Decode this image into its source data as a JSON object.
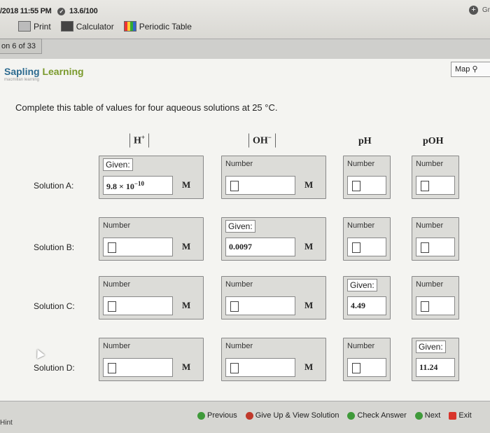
{
  "top": {
    "datetime": "/2018 11:55 PM",
    "score": "13.6/100",
    "gr_label": "Gr"
  },
  "tools": [
    "Print",
    "Calculator",
    "Periodic Table"
  ],
  "question_counter": "on 6 of 33",
  "logo": {
    "name_a": "Sapling",
    "name_b": " Learning",
    "sub": "macmillan learning"
  },
  "map_label": "Map",
  "prompt": "Complete this table of values for four aqueous solutions at 25 °C.",
  "columns": {
    "h": "H",
    "h_sup": "+",
    "oh": "OH",
    "oh_sup": "−",
    "ph": "pH",
    "poh": "pOH"
  },
  "unit": "M",
  "labels": {
    "number": "Number",
    "given": "Given:"
  },
  "rows": [
    {
      "label": "Solution A:",
      "h_value": "9.8 × 10",
      "h_exp": "−10"
    },
    {
      "label": "Solution B:",
      "oh_value": "0.0097"
    },
    {
      "label": "Solution C:",
      "ph_value": "4.49"
    },
    {
      "label": "Solution D:",
      "poh_value": "11.24"
    }
  ],
  "footer": {
    "hint": "Hint",
    "previous": "Previous",
    "giveup": "Give Up & View Solution",
    "check": "Check Answer",
    "next": "Next",
    "exit": "Exit"
  },
  "colors": {
    "accent_green": "#3f9a3a",
    "give_up_red": "#c0392b",
    "exit_red": "#d9342b",
    "logo_blue": "#2c6a8f"
  }
}
